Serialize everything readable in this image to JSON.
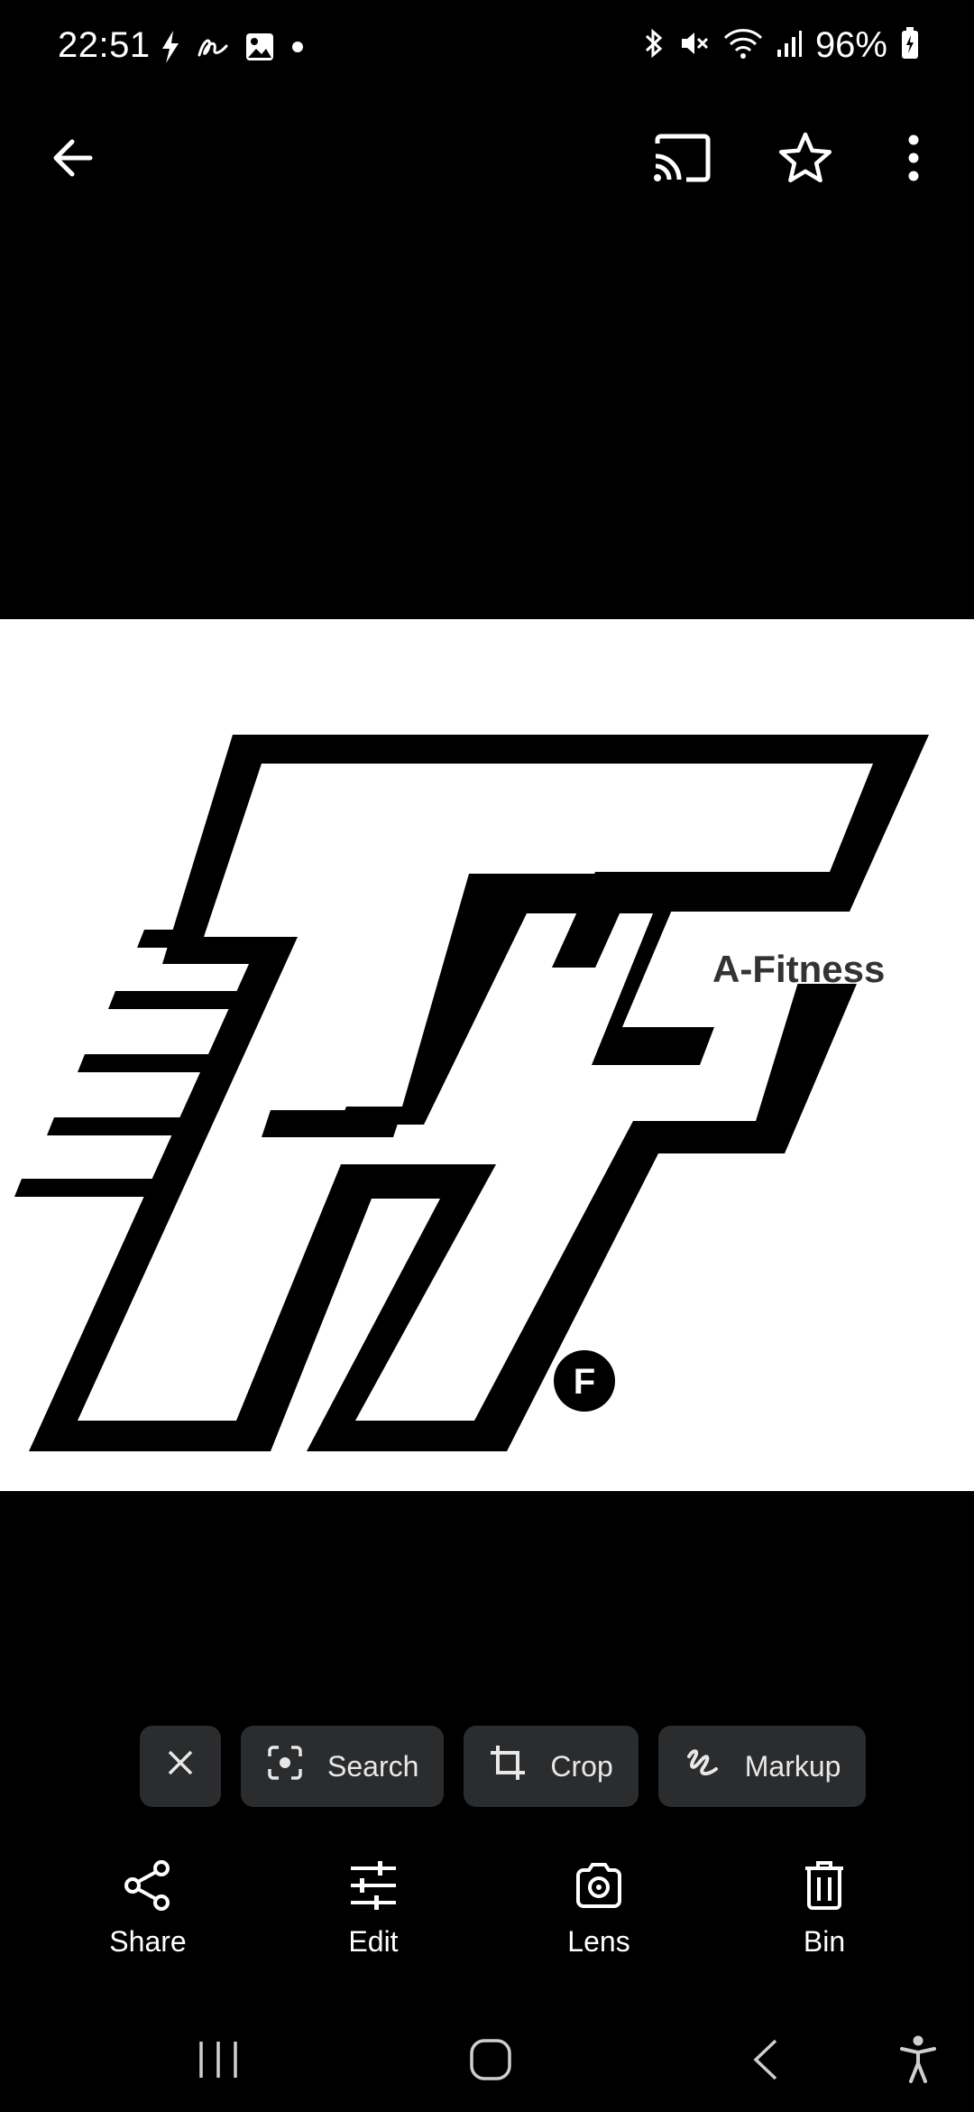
{
  "status_bar": {
    "time": "22:51",
    "battery": "96%",
    "left_icons": [
      "flash-icon",
      "sign-icon",
      "gallery-icon",
      "dot-icon"
    ],
    "right_icons": [
      "bluetooth-icon",
      "mute-icon",
      "wifi-icon",
      "signal-icon",
      "battery-icon"
    ]
  },
  "top_bar": {
    "icons": [
      "back-arrow-icon",
      "cast-icon",
      "star-icon",
      "more-vert-icon"
    ]
  },
  "image": {
    "logo_text": "A-Fitness",
    "logo_badge": "F"
  },
  "chips": {
    "close_icon": "close-icon",
    "search_label": "Search",
    "crop_label": "Crop",
    "markup_label": "Markup"
  },
  "actions": [
    {
      "label": "Share",
      "icon": "share-icon"
    },
    {
      "label": "Edit",
      "icon": "sliders-icon"
    },
    {
      "label": "Lens",
      "icon": "lens-icon"
    },
    {
      "label": "Bin",
      "icon": "trash-icon"
    }
  ],
  "nav_bar": {
    "icons": [
      "recents-icon",
      "home-icon",
      "back-icon",
      "accessibility-icon"
    ]
  },
  "colors": {
    "background": "#000000",
    "chip_bg": "#2b2c2e",
    "image_bg": "#ffffff"
  }
}
